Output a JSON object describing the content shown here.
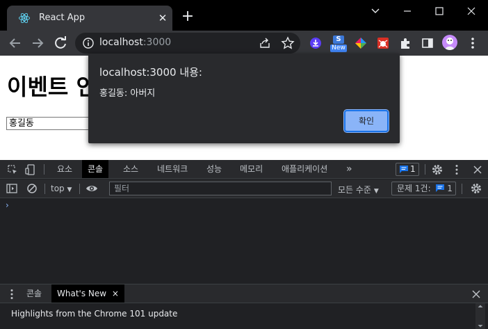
{
  "browser": {
    "tab_title": "React App",
    "url_host": "localhost",
    "url_port": ":3000",
    "ext_badge": "New"
  },
  "page": {
    "heading": "이벤트 인",
    "input_value": "홍길동"
  },
  "alert": {
    "title": "localhost:3000 내용:",
    "message": "홍길동: 아버지",
    "ok_label": "확인"
  },
  "devtools": {
    "tabs": [
      "요소",
      "콘솔",
      "소스",
      "네트워크",
      "성능",
      "메모리",
      "애플리케이션"
    ],
    "more": "»",
    "issue_count": "1",
    "context": "top",
    "filter_placeholder": "필터",
    "levels": "모든 수준",
    "issues_label": "문제 1건:",
    "issues_count": "1",
    "prompt": "›",
    "drawer_tabs": [
      "콘솔",
      "What's New"
    ],
    "drawer_close": "×",
    "whats_new_text": "Highlights from the Chrome 101 update"
  },
  "colors": {
    "accent": "#8ab4f8",
    "react": "#61dafb"
  }
}
